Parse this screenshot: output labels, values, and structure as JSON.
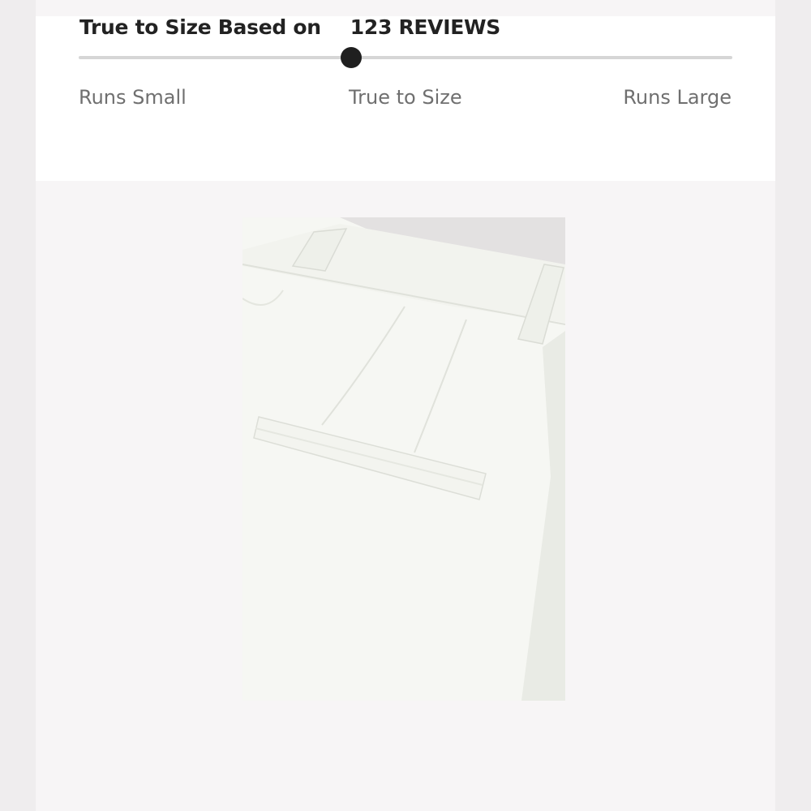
{
  "fit_rating": {
    "heading": "True to Size Based on",
    "reviews": "123 REVIEWS",
    "scale_position": 0.417,
    "labels": {
      "small": "Runs Small",
      "mid": "True to Size",
      "large": "Runs Large"
    }
  },
  "product_image": {
    "subject": "white trousers detail",
    "colors": {
      "fabric": "#f6f7f3",
      "shadow": "#e6e8e2",
      "background": "#e4e2e2"
    }
  }
}
